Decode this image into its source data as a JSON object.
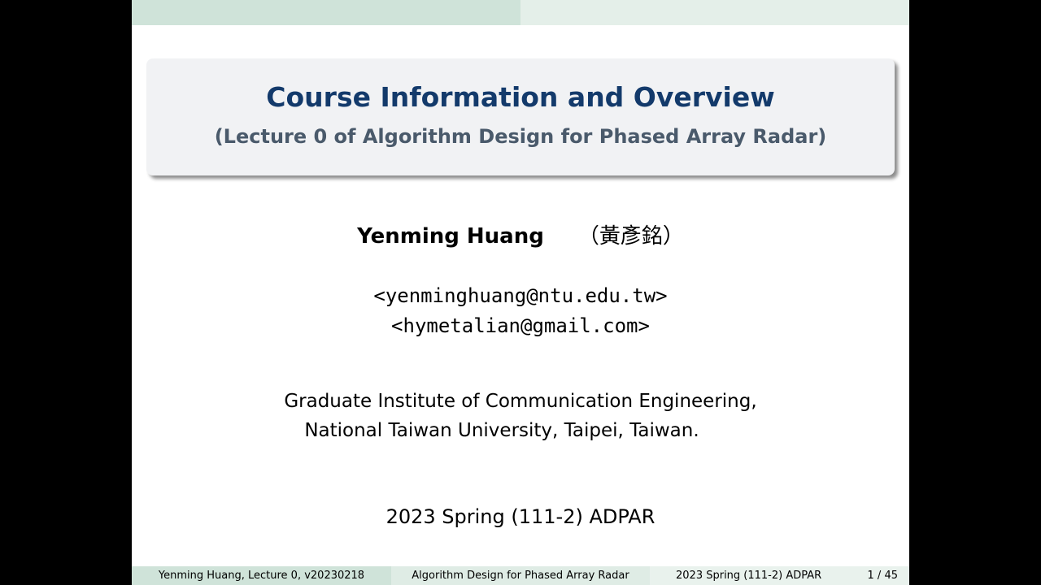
{
  "slide": {
    "title": "Course Information and Overview",
    "subtitle": "(Lecture 0 of Algorithm Design for Phased Array Radar)",
    "author": "Yenming Huang",
    "author_cjk": "（黃彥銘）",
    "emails": [
      "<yenminghuang@ntu.edu.tw>",
      "<hymetalian@gmail.com>"
    ],
    "affiliation": [
      "Graduate Institute of Communication Engineering,",
      "National Taiwan University, Taipei, Taiwan."
    ],
    "term": "2023 Spring (111-2) ADPAR"
  },
  "footer": {
    "left": "Yenming Huang, Lecture 0, v20230218",
    "center": "Algorithm Design for Phased Array Radar",
    "right": "2023 Spring (111-2) ADPAR",
    "page": "1 / 45"
  },
  "colors": {
    "title": "#133a6b",
    "subtitle": "#4a5a6b",
    "title_box_bg": "#f1f2f4",
    "band_dark": "#cfe3d9",
    "band_light": "#e4efe9"
  }
}
